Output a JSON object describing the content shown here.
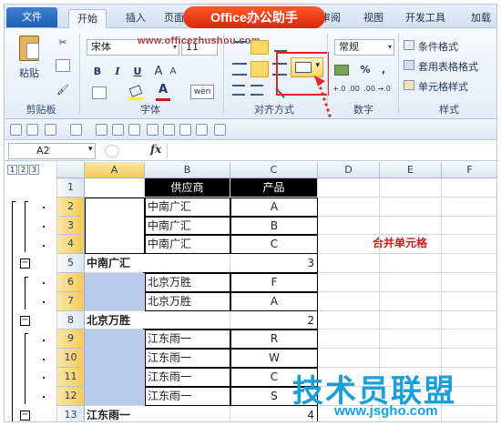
{
  "banner": "Office办公助手",
  "watermark_url": "www.officezhushou.com",
  "tabs": {
    "file": "文件",
    "home": "开始",
    "insert": "插入",
    "page": "页面",
    "review": "审阅",
    "view": "视图",
    "developer": "开发工具",
    "addins": "加载"
  },
  "ribbon": {
    "paste": "粘贴",
    "clipboard": "剪贴板",
    "font_name": "宋体",
    "font_size": "11",
    "font_group": "字体",
    "bold": "B",
    "italic": "I",
    "underline": "U",
    "grow_font": "A",
    "shrink_font": "A",
    "font_color": "A",
    "phonetic": "wén",
    "align_group": "对齐方式",
    "number_format": "常规",
    "percent": "%",
    "comma": ",",
    "inc_decimal": "+.0 .00",
    "dec_decimal": ".00 →.0",
    "number_group": "数字",
    "conditional_format": "条件格式",
    "format_table": "套用表格格式",
    "cell_styles": "单元格样式",
    "styles_group": "样式",
    "dropdown_arrow": "▾"
  },
  "formula_bar": {
    "name_box": "A2",
    "fx": "fx"
  },
  "outline_levels": [
    "1",
    "2",
    "3"
  ],
  "columns": [
    "A",
    "B",
    "C",
    "D",
    "E",
    "F"
  ],
  "rows": [
    "1",
    "2",
    "3",
    "4",
    "5",
    "6",
    "7",
    "8",
    "9",
    "10",
    "11",
    "12",
    "13"
  ],
  "table": {
    "header_supplier": "供应商",
    "header_product": "产品",
    "b2": "中南广汇",
    "c2": "A",
    "b3": "中南广汇",
    "c3": "B",
    "b4": "中南广汇",
    "c4": "C",
    "a5": "中南广汇",
    "c5": "3",
    "b6": "北京万胜",
    "c6": "F",
    "b7": "北京万胜",
    "c7": "A",
    "a8": "北京万胜",
    "c8": "2",
    "b9": "江东雨一",
    "c9": "R",
    "b10": "江东雨一",
    "c10": "W",
    "b11": "江东雨一",
    "c11": "C",
    "b12": "江东雨一",
    "c12": "S",
    "a13": "江东雨一",
    "c13": "4"
  },
  "annotation": "合并单元格",
  "collapse_symbol": "−",
  "logo": {
    "main": "技术员联盟",
    "sub": "www.jsgho.com"
  }
}
